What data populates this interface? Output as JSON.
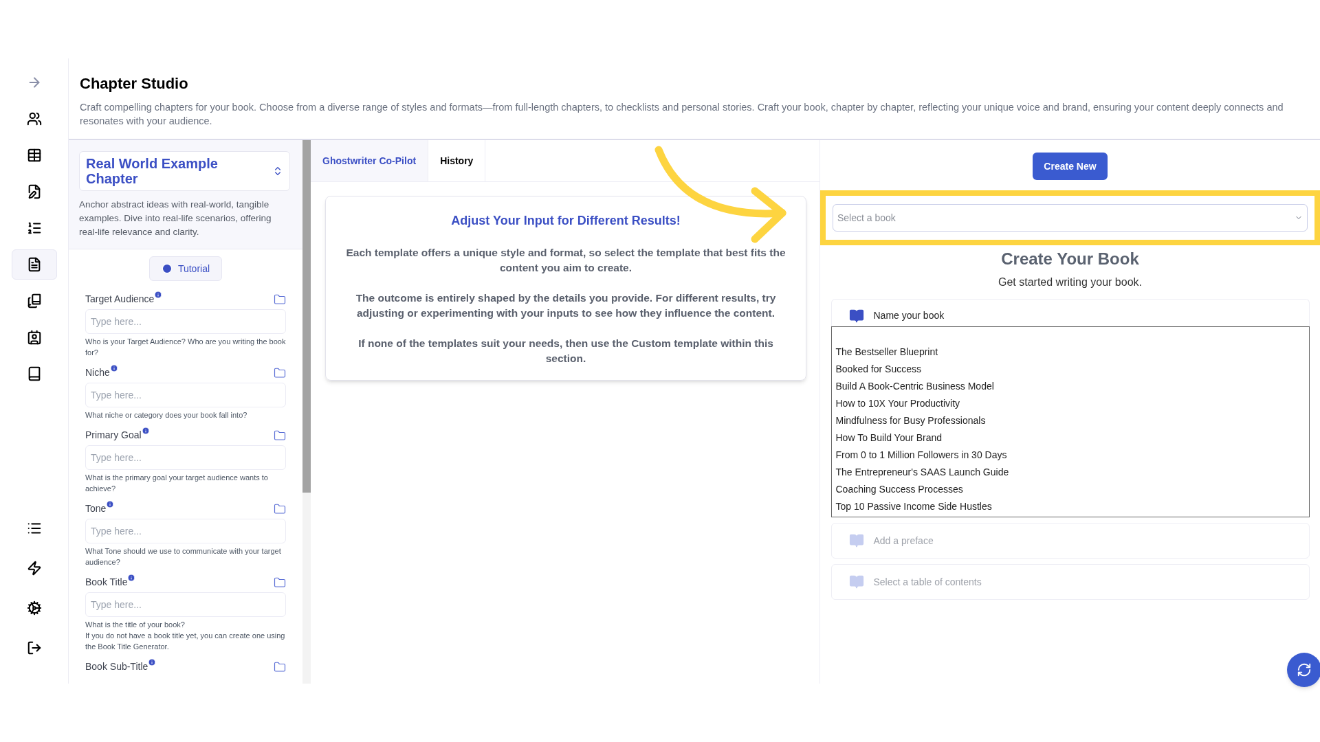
{
  "sidebar": {
    "items": [
      {
        "selected": false
      },
      {
        "selected": false
      },
      {
        "selected": false
      },
      {
        "selected": false
      },
      {
        "selected": false
      },
      {
        "selected": true
      },
      {
        "selected": false
      },
      {
        "selected": false
      },
      {
        "selected": false
      }
    ],
    "bottom_items": [
      {
        "selected": false
      },
      {
        "selected": false
      },
      {
        "selected": false
      },
      {
        "selected": false
      }
    ]
  },
  "header": {
    "title": "Chapter Studio",
    "description": "Craft compelling chapters for your book. Choose from a diverse range of styles and formats—from full-length chapters, to checklists and personal stories. Craft your book, chapter by chapter, reflecting your unique voice and brand, ensuring your content deeply connects and resonates with your audience."
  },
  "template": {
    "name": "Real World Example Chapter",
    "description": "Anchor abstract ideas with real-world, tangible examples. Dive into real-life scenarios, offering real-life relevance and clarity.",
    "tutorial_button": "Tutorial"
  },
  "fields": [
    {
      "label": "Target Audience",
      "placeholder": "Type here...",
      "help": [
        "Who is your Target Audience? Who are you writing the book for?"
      ]
    },
    {
      "label": "Niche",
      "placeholder": "Type here...",
      "help": [
        "What niche or category does your book fall into?"
      ]
    },
    {
      "label": "Primary Goal",
      "placeholder": "Type here...",
      "help": [
        "What is the primary goal your target audience wants to achieve?"
      ]
    },
    {
      "label": "Tone",
      "placeholder": "Type here...",
      "help": [
        "What Tone should we use to communicate with your target audience?"
      ]
    },
    {
      "label": "Book Title",
      "placeholder": "Type here...",
      "help": [
        "What is the title of your book?",
        "If you do not have a book title yet, you can create one using the Book Title Generator."
      ]
    },
    {
      "label": "Book Sub-Title"
    }
  ],
  "tabs": [
    {
      "label": "Ghostwriter Co-Pilot",
      "selected": true
    },
    {
      "label": "History",
      "selected": false
    }
  ],
  "info_card": {
    "title": "Adjust Your Input for Different Results!",
    "paragraphs": [
      "Each template offers a unique style and format, so select the template that best fits the content you aim to create.",
      "The outcome is entirely shaped by the details you provide. For different results, try adjusting or experimenting with your inputs to see how they influence the content.",
      "If none of the templates suit your needs, then use the **Custom** template within this section."
    ]
  },
  "book_panel": {
    "create_button": "Create New",
    "book_select": {
      "placeholder": "Select a book"
    },
    "title": "Create Your Book",
    "subtitle": "Get started writing your book.",
    "steps": [
      {
        "label": "Name your book",
        "disabled": false
      },
      {
        "label": "Add a preface",
        "disabled": true
      },
      {
        "label": "Select a table of contents",
        "disabled": true
      }
    ],
    "book_options": [
      "The Bestseller Blueprint",
      "Booked for Success",
      "Build A Book-Centric Business Model",
      "How to 10X Your Productivity",
      "Mindfulness for Busy Professionals",
      "How To Build Your Brand",
      "From 0 to 1 Million Followers in 30 Days",
      "The Entrepreneur's SAAS Launch Guide",
      "Coaching Success Processes",
      "Top 10 Passive Income Side Hustles"
    ]
  }
}
